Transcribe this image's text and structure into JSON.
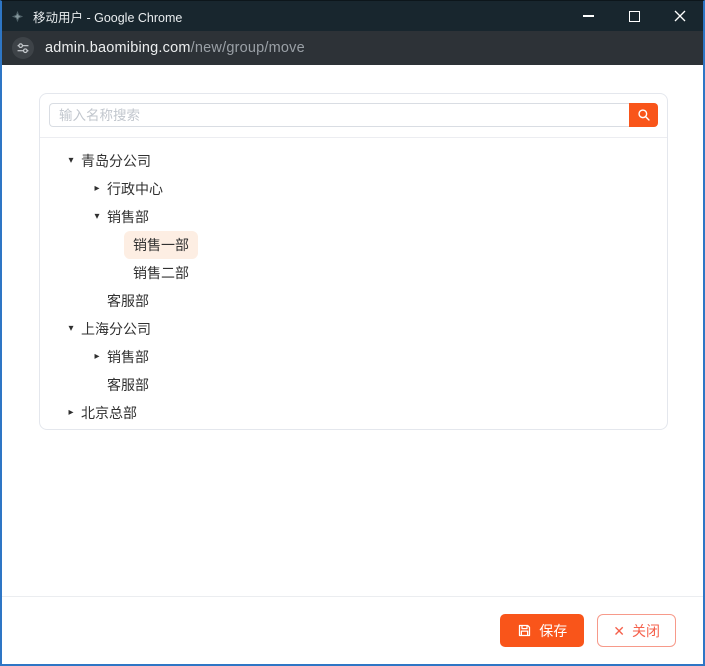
{
  "window": {
    "title": "移动用户 - Google Chrome"
  },
  "address_bar": {
    "domain": "admin.baomibing.com",
    "path": "/new/group/move"
  },
  "search": {
    "placeholder": "输入名称搜索"
  },
  "icons": {
    "tree_expanded": "▾",
    "tree_collapsed": "▸",
    "close_x": "✕",
    "search": "magnifier",
    "save": "floppy-disk",
    "site_info": "tune-sliders",
    "minimize": "minimize-bar",
    "maximize": "maximize-box",
    "window_close": "close-x"
  },
  "tree": {
    "nodes": [
      {
        "label": "青岛分公司",
        "level": 1,
        "state": "expanded",
        "selected": false
      },
      {
        "label": "行政中心",
        "level": 2,
        "state": "collapsed",
        "selected": false
      },
      {
        "label": "销售部",
        "level": 2,
        "state": "expanded",
        "selected": false
      },
      {
        "label": "销售一部",
        "level": 3,
        "state": "leaf",
        "selected": true
      },
      {
        "label": "销售二部",
        "level": 3,
        "state": "leaf",
        "selected": false
      },
      {
        "label": "客服部",
        "level": 2,
        "state": "leaf",
        "selected": false
      },
      {
        "label": "上海分公司",
        "level": 1,
        "state": "expanded",
        "selected": false
      },
      {
        "label": "销售部",
        "level": 2,
        "state": "collapsed",
        "selected": false
      },
      {
        "label": "客服部",
        "level": 2,
        "state": "leaf",
        "selected": false
      },
      {
        "label": "北京总部",
        "level": 1,
        "state": "collapsed",
        "selected": false
      }
    ]
  },
  "footer": {
    "save_label": "保存",
    "close_label": "关闭"
  },
  "colors": {
    "accent": "#f9551a",
    "close_text": "#f5604b",
    "close_border": "#f79a8a",
    "selected_bg": "#fdeee3",
    "window_border": "#2e76c5",
    "titlebar_bg": "#18262e",
    "addressbar_bg": "#2d3237"
  }
}
